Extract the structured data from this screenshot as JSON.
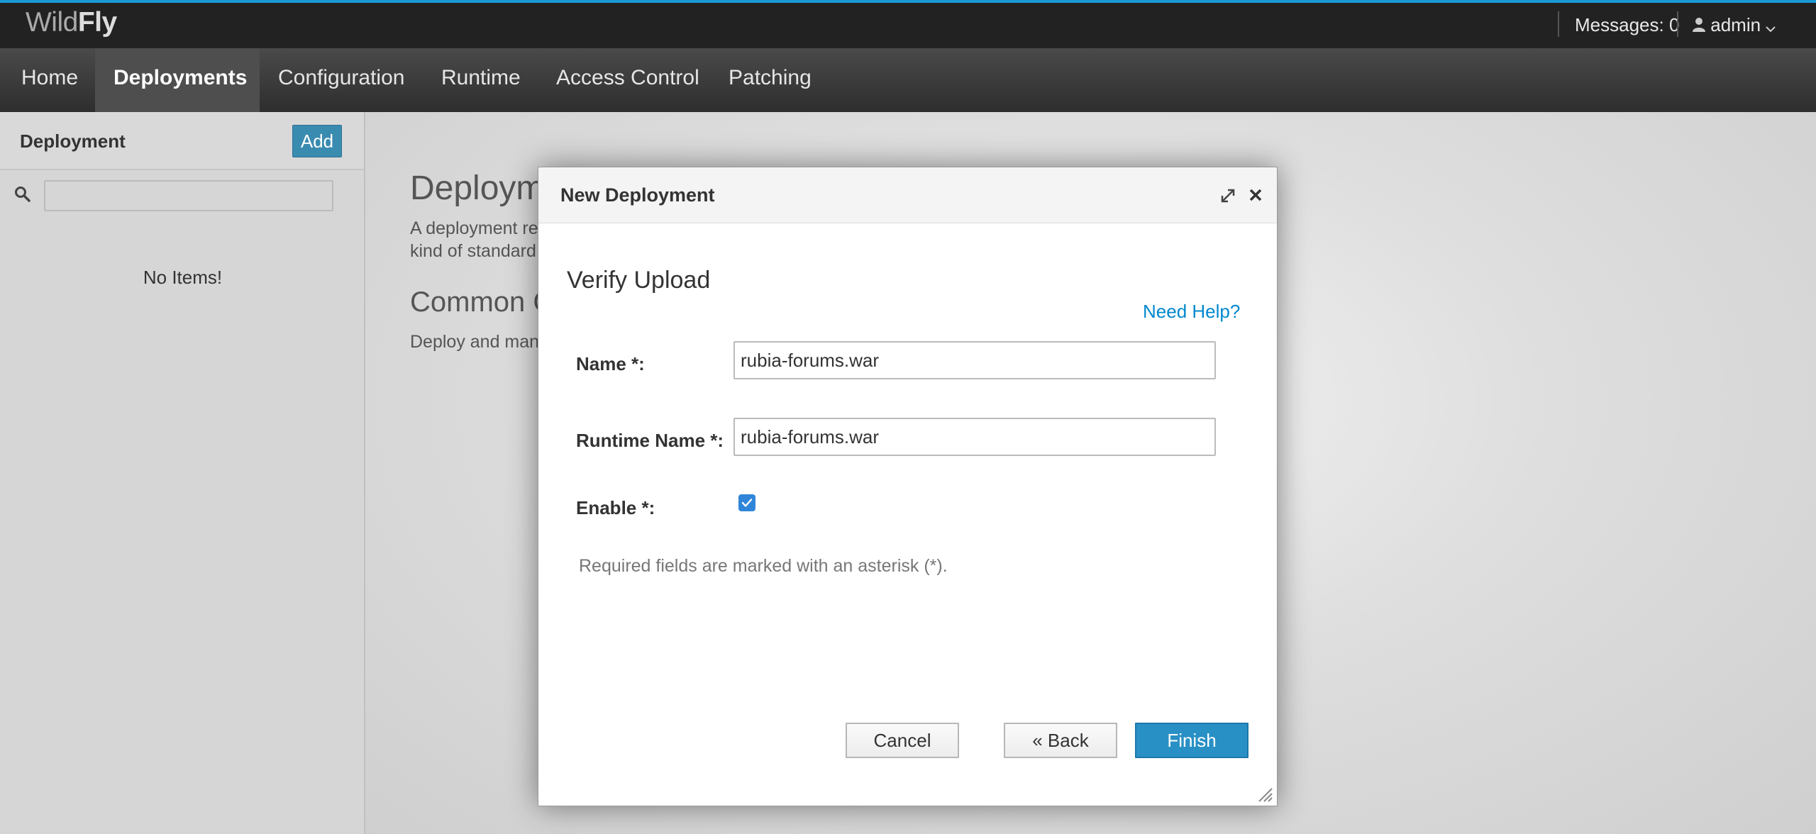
{
  "header": {
    "logo_light": "Wild",
    "logo_bold": "Fly",
    "messages": "Messages: 0",
    "user": "admin"
  },
  "nav": {
    "items": [
      {
        "label": "Home"
      },
      {
        "label": "Deployments",
        "active": true
      },
      {
        "label": "Configuration"
      },
      {
        "label": "Runtime"
      },
      {
        "label": "Access Control"
      },
      {
        "label": "Patching"
      }
    ]
  },
  "sidebar": {
    "title": "Deployment",
    "add_label": "Add",
    "search_value": "",
    "empty_text": "No Items!"
  },
  "main": {
    "title": "Deploym",
    "desc_line1": "A deployment re",
    "desc_line2": "kind of standard",
    "h2": "Common C",
    "desc2": "Deploy and man"
  },
  "modal": {
    "title": "New Deployment",
    "step_title": "Verify Upload",
    "help_link": "Need Help?",
    "name_label": "Name *:",
    "name_value": "rubia-forums.war",
    "runtime_name_label": "Runtime Name *:",
    "runtime_name_value": "rubia-forums.war",
    "enable_label": "Enable *:",
    "enable_checked": true,
    "hint": "Required fields are marked with an asterisk (*).",
    "cancel_label": "Cancel",
    "back_label": "« Back",
    "finish_label": "Finish"
  },
  "icons": {
    "search": "search-icon",
    "user": "user-icon",
    "maximize": "maximize-icon",
    "close": "close-icon",
    "resize": "resize-handle-icon"
  },
  "colors": {
    "accent": "#1a9ad4",
    "primary_button": "#2990c6",
    "link": "#0088ce",
    "checkbox": "#2f86d9"
  }
}
